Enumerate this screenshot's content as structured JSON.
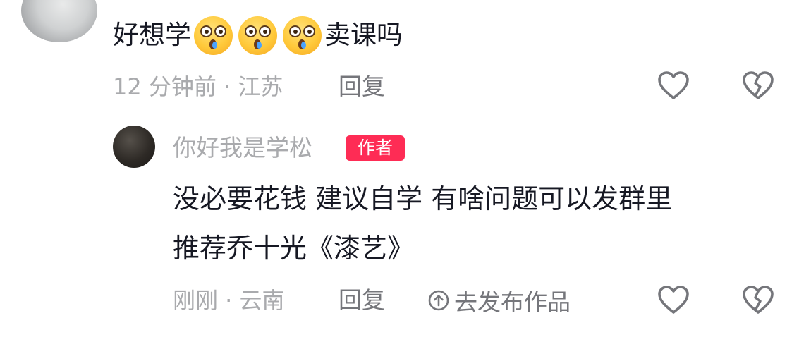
{
  "comment": {
    "text_before": "好想学",
    "emojis": [
      "astonished-crying-emoji",
      "astonished-crying-emoji",
      "astonished-crying-emoji"
    ],
    "text_after": "卖课吗",
    "meta": "12 分钟前 · 江苏",
    "reply_label": "回复"
  },
  "reply": {
    "username": "你好我是学松",
    "badge": "作者",
    "line1": "没必要花钱 建议自学 有啥问题可以发群里",
    "line2": "推荐乔十光《漆艺》",
    "meta": "刚刚 · 云南",
    "reply_label": "回复",
    "publish_label": "去发布作品"
  },
  "colors": {
    "badge": "#fe2c55",
    "meta_text": "#a9aaad",
    "action_text": "#75767b"
  }
}
